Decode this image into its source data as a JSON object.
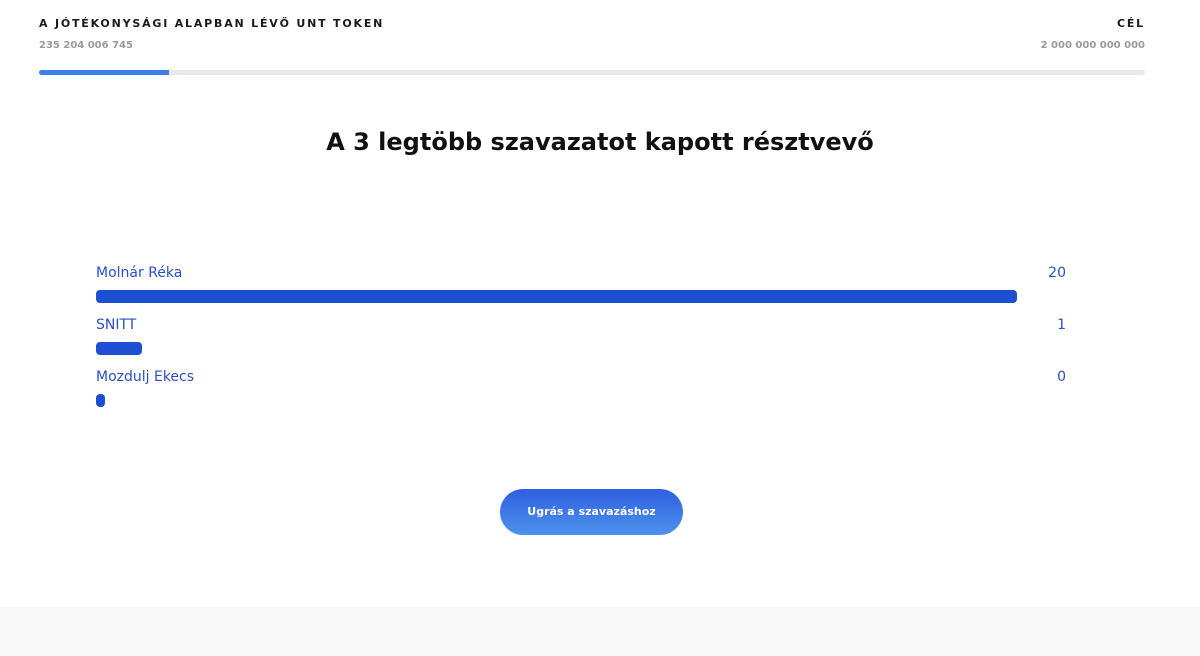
{
  "funding": {
    "label": "A JÓTÉKONYSÁGI ALAPBAN LÉVŐ UNT TOKEN",
    "amount": "235 204 006 745",
    "goal_label": "CÉL",
    "goal_amount": "2 000 000 000 000",
    "progress_fraction": 0.1176,
    "accent_color": "#3b7ee8"
  },
  "title": "A 3 legtöbb szavazatot kapott résztvevő",
  "ranking": {
    "bar_color": "#1c4fd1",
    "text_color": "#2a4fc7",
    "max_votes": 20,
    "items": [
      {
        "name": "Molnár Réka",
        "votes": "20"
      },
      {
        "name": "SNITT",
        "votes": "1"
      },
      {
        "name": "Mozdulj Ekecs",
        "votes": "0"
      }
    ]
  },
  "cta": {
    "label": "Ugrás a szavazáshoz"
  }
}
